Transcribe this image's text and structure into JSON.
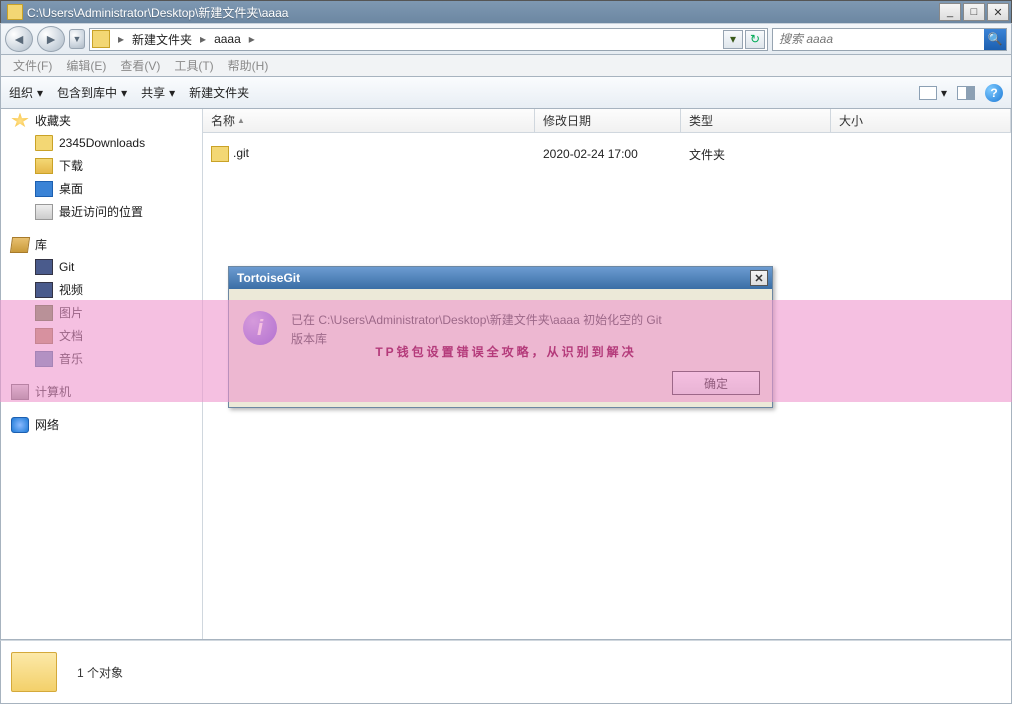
{
  "title": "C:\\Users\\Administrator\\Desktop\\新建文件夹\\aaaa",
  "breadcrumbs": [
    "新建文件夹",
    "aaaa"
  ],
  "search": {
    "placeholder": "搜索 aaaa"
  },
  "menu": {
    "file": "文件(F)",
    "edit": "编辑(E)",
    "view": "查看(V)",
    "tools": "工具(T)",
    "help": "帮助(H)"
  },
  "toolbar": {
    "org": "组织",
    "include": "包含到库中",
    "share": "共享",
    "newfolder": "新建文件夹"
  },
  "columns": {
    "name": "名称",
    "date": "修改日期",
    "type": "类型",
    "size": "大小"
  },
  "files": [
    {
      "name": ".git",
      "date": "2020-02-24 17:00",
      "type": "文件夹",
      "size": ""
    }
  ],
  "sidebar": {
    "fav": "收藏夹",
    "fav_items": {
      "dl": "2345Downloads",
      "down": "下载",
      "desk": "桌面",
      "recent": "最近访问的位置"
    },
    "lib": "库",
    "lib_items": {
      "git": "Git",
      "video": "视频",
      "pics": "图片",
      "docs": "文档",
      "music": "音乐"
    },
    "pc": "计算机",
    "net": "网络"
  },
  "dialog": {
    "title": "TortoiseGit",
    "msg1": "已在 C:\\Users\\Administrator\\Desktop\\新建文件夹\\aaaa 初始化空的 Git",
    "msg2": "版本库",
    "ok": "确定"
  },
  "banner": "TP钱包设置错误全攻略，从识别到解决",
  "status": {
    "count": "1 个对象"
  }
}
